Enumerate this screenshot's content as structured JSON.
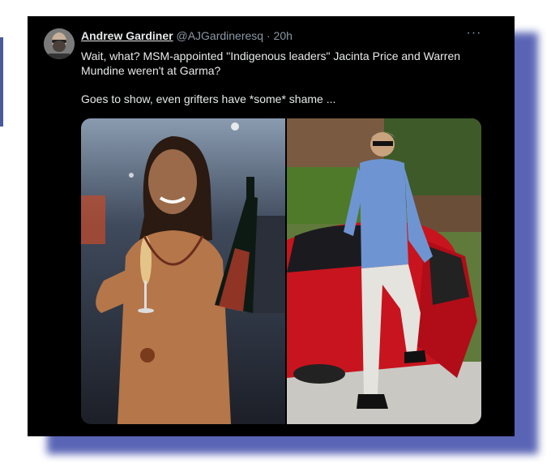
{
  "tweet": {
    "author_name": "Andrew Gardiner",
    "author_handle": "@AJGardineresq",
    "separator": "·",
    "timestamp": "20h",
    "more_icon": "more-horizontal-icon",
    "text_lines": [
      "Wait, what? MSM-appointed \"Indigenous leaders\" Jacinta Price and Warren Mundine weren't at Garma?",
      "Goes to show, even grifters have *some* shame ..."
    ],
    "media": [
      {
        "description": "photo-woman-holding-champagne"
      },
      {
        "description": "photo-man-with-red-sports-car"
      }
    ]
  },
  "colors": {
    "card_background": "#000000",
    "text": "#e7e9ea",
    "secondary_text": "#8b98a5",
    "frame_shadow": "#3d4aa8"
  }
}
